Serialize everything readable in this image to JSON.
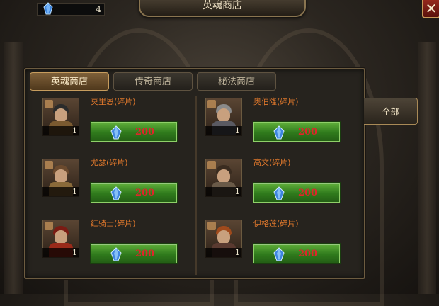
{
  "header": {
    "gems": "4",
    "title": "英魂商店",
    "close_icon": "✕"
  },
  "tabs": [
    {
      "label": "英魂商店",
      "active": true
    },
    {
      "label": "传奇商店",
      "active": false
    },
    {
      "label": "秘法商店",
      "active": false
    }
  ],
  "filter": {
    "label": "全部"
  },
  "items": [
    {
      "name": "莫里恩(碎片)",
      "count": "1",
      "price": "200",
      "hair": "#2b2b2b",
      "body": "#7a5a30"
    },
    {
      "name": "奥伯隆(碎片)",
      "count": "1",
      "price": "200",
      "hair": "#8a8a8a",
      "body": "#5a5a62"
    },
    {
      "name": "尤瑟(碎片)",
      "count": "1",
      "price": "200",
      "hair": "#6b4a2e",
      "body": "#8a6a3a"
    },
    {
      "name": "高文(碎片)",
      "count": "1",
      "price": "200",
      "hair": "#3a2c20",
      "body": "#6a5a48"
    },
    {
      "name": "红骑士(碎片)",
      "count": "1",
      "price": "200",
      "hair": "#7a1c14",
      "body": "#9a2a1a"
    },
    {
      "name": "伊格莲(碎片)",
      "count": "1",
      "price": "200",
      "hair": "#a04a1c",
      "body": "#5a3a30"
    }
  ],
  "colors": {
    "price": "#e0252a",
    "item_name": "#e0782c",
    "buy_button": "#2f7a1c",
    "tab_active": "#7e6039"
  },
  "icons": {
    "currency": "blue-crystal-icon",
    "fragment": "puzzle-piece-icon"
  }
}
